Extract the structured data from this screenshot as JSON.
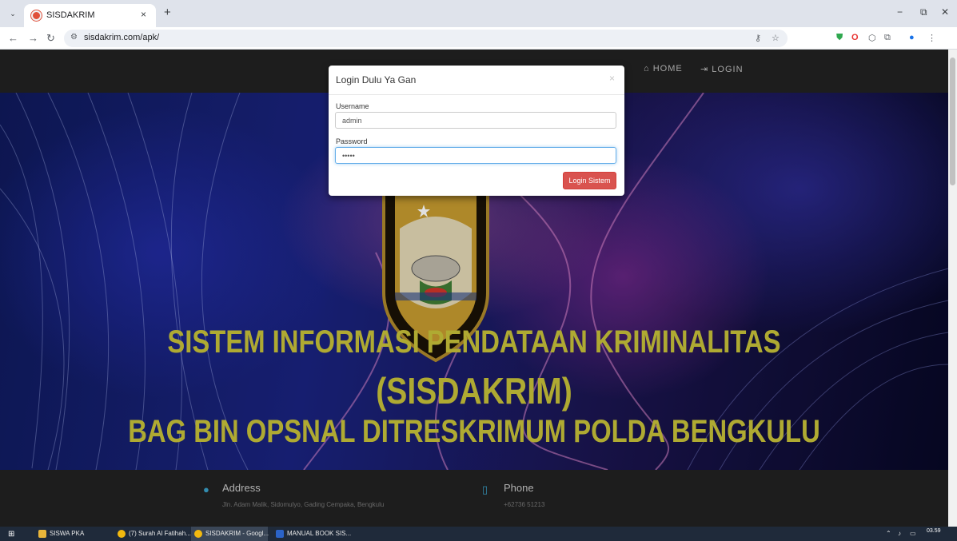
{
  "browser": {
    "tab_title": "SISDAKRIM",
    "tab_close": "×",
    "new_tab": "+",
    "url": "sisdakrim.com/apk/"
  },
  "page": {
    "nav": {
      "home": "HOME",
      "login": "LOGIN"
    },
    "hero": {
      "line1": "SISTEM INFORMASI PENDATAAN KRIMINALITAS",
      "line2": "(SISDAKRIM)",
      "line3": "BAG BIN OPSNAL DITRESKRIMUM POLDA BENGKULU"
    },
    "footer": {
      "address_title": "Address",
      "address_text": "Jln. Adam Malik, Sidomulyo, Gading Cempaka, Bengkulu",
      "phone_title": "Phone",
      "phone_text": "+62736 51213"
    }
  },
  "modal": {
    "title": "Login Dulu Ya Gan",
    "close": "×",
    "username_label": "Username",
    "username_value": "admin",
    "password_label": "Password",
    "password_value": "•••••",
    "submit_label": "Login Sistem"
  },
  "taskbar": {
    "items": [
      {
        "label": "SISWA PKA"
      },
      {
        "label": "(7) Surah Al Fatihah..."
      },
      {
        "label": "SISDAKRIM - Googl..."
      },
      {
        "label": "MANUAL BOOK SIS..."
      }
    ],
    "clock": "03.59"
  },
  "colors": {
    "hero_text": "#c8c23a",
    "login_button": "#d9534f",
    "footer_icon": "#3aa0c8"
  }
}
